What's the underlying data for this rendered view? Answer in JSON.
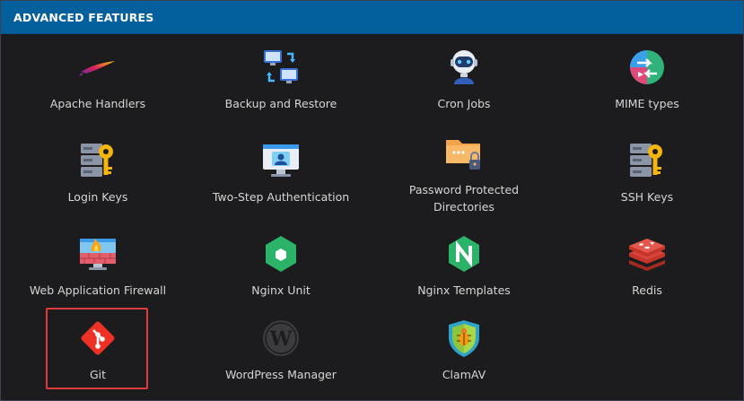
{
  "header": {
    "title": "ADVANCED FEATURES"
  },
  "tiles": [
    {
      "label": "Apache Handlers",
      "icon": "apache-feather-icon"
    },
    {
      "label": "Backup and Restore",
      "icon": "backup-monitors-icon"
    },
    {
      "label": "Cron Jobs",
      "icon": "robot-icon"
    },
    {
      "label": "MIME types",
      "icon": "mime-globe-icon"
    },
    {
      "label": "Login Keys",
      "icon": "server-key-icon"
    },
    {
      "label": "Two-Step Authentication",
      "icon": "monitor-user-icon"
    },
    {
      "label": "Password Protected\nDirectories",
      "icon": "folder-lock-icon"
    },
    {
      "label": "SSH Keys",
      "icon": "server-key-icon"
    },
    {
      "label": "Web Application Firewall",
      "icon": "firewall-icon"
    },
    {
      "label": "Nginx Unit",
      "icon": "nginx-unit-icon"
    },
    {
      "label": "Nginx Templates",
      "icon": "nginx-icon"
    },
    {
      "label": "Redis",
      "icon": "redis-icon"
    },
    {
      "label": "Git",
      "icon": "git-icon"
    },
    {
      "label": "WordPress Manager",
      "icon": "wordpress-icon"
    },
    {
      "label": "ClamAV",
      "icon": "clamav-shield-icon"
    }
  ]
}
